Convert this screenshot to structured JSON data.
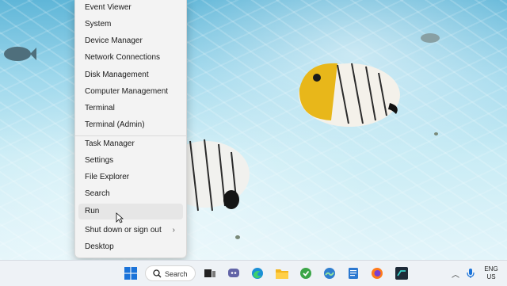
{
  "context_menu": {
    "items": [
      {
        "label": "Event Viewer"
      },
      {
        "label": "System"
      },
      {
        "label": "Device Manager"
      },
      {
        "label": "Network Connections"
      },
      {
        "label": "Disk Management"
      },
      {
        "label": "Computer Management"
      },
      {
        "label": "Terminal"
      },
      {
        "label": "Terminal (Admin)"
      },
      {
        "label": "Task Manager"
      },
      {
        "label": "Settings"
      },
      {
        "label": "File Explorer"
      },
      {
        "label": "Search"
      },
      {
        "label": "Run"
      },
      {
        "label": "Shut down or sign out"
      },
      {
        "label": "Desktop"
      }
    ],
    "hovered_item": "Run"
  },
  "taskbar": {
    "search_label": "Search",
    "apps": [
      "start-icon",
      "search-icon",
      "task-view-icon",
      "chat-icon",
      "edge-icon",
      "file-explorer-icon",
      "app-green-icon",
      "maps-icon",
      "notepad-icon",
      "firefox-icon",
      "terminal-app-icon"
    ],
    "tray": {
      "language_line1": "ENG",
      "language_line2": "US"
    }
  },
  "colors": {
    "menu_bg": "#f3f3f3",
    "taskbar_bg": "#eef2f6",
    "accent": "#0067c0"
  }
}
